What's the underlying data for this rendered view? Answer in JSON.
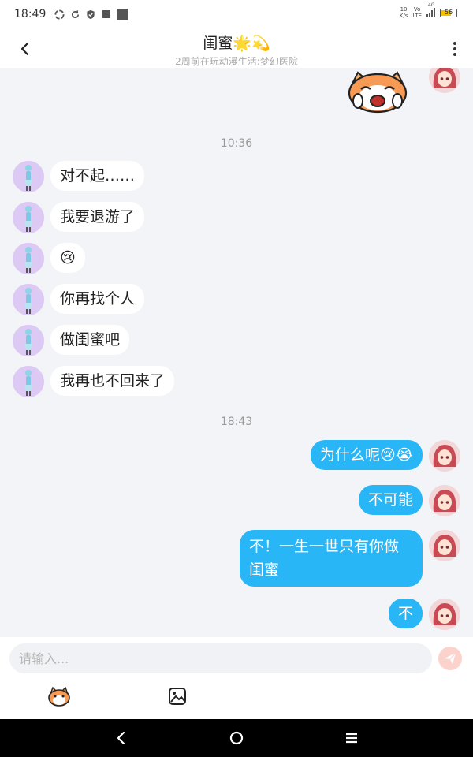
{
  "status_bar": {
    "time": "18:49",
    "net_speed_top": "10",
    "net_speed_bottom": "K/s",
    "volte_top": "Vo",
    "volte_bottom": "LTE",
    "network_type": "4G",
    "battery": "56"
  },
  "header": {
    "title": "闺蜜🌟💫",
    "subtitle": "2周前在玩动漫生活:梦幻医院"
  },
  "timestamps": [
    "10:36",
    "18:43"
  ],
  "messages_left": [
    {
      "text": "对不起……"
    },
    {
      "text": "我要退游了"
    },
    {
      "text": "😢"
    },
    {
      "text": "你再找个人"
    },
    {
      "text": "做闺蜜吧"
    },
    {
      "text": "我再也不回来了"
    }
  ],
  "messages_right": [
    {
      "text": "为什么呢😢😭"
    },
    {
      "text": "不可能"
    },
    {
      "text": "不！一生一世只有你做闺蜜"
    },
    {
      "text": "不"
    }
  ],
  "input": {
    "placeholder": "请输入..."
  },
  "icons": {
    "back": "chevron-left-icon",
    "more": "more-vertical-icon",
    "send": "send-icon",
    "sticker_tool": "sticker-icon",
    "image_tool": "image-icon"
  },
  "colors": {
    "outgoing_bubble": "#29b6f6",
    "incoming_bubble": "#ffffff",
    "chat_background": "#f3f4f8",
    "send_button": "#fbd3cc"
  }
}
